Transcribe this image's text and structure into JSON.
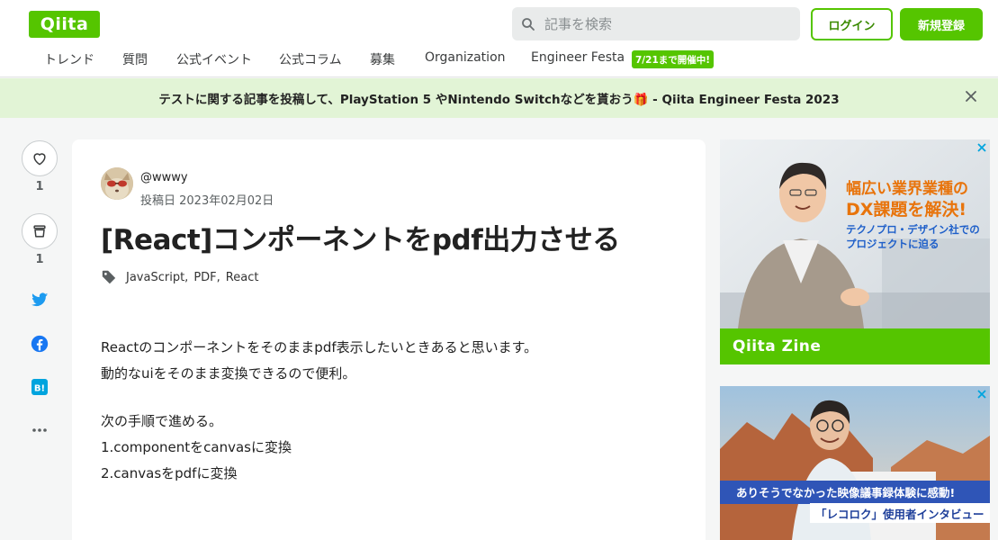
{
  "header": {
    "logo": "Qiita",
    "search_placeholder": "記事を検索",
    "login_label": "ログイン",
    "signup_label": "新規登録",
    "nav": [
      "トレンド",
      "質問",
      "公式イベント",
      "公式コラム",
      "募集",
      "Organization",
      "Engineer Festa"
    ],
    "nav_badge": "7/21まで開催中!"
  },
  "banner": {
    "text": "テストに関する記事を投稿して、PlayStation 5 やNintendo Switchなどを貰おう🎁 - Qiita Engineer Festa 2023"
  },
  "rail": {
    "likes_count": "1",
    "stocks_count": "1"
  },
  "article": {
    "username": "@wwwy",
    "posted": "投稿日 2023年02月02日",
    "title": "[React]コンポーネントをpdf出力させる",
    "tags": [
      "JavaScript",
      "PDF",
      "React"
    ],
    "body": [
      "Reactのコンポーネントをそのままpdf表示したいときあると思います。",
      "動的なuiをそのまま変換できるので便利。",
      "次の手順で進める。",
      "1.componentをcanvasに変換",
      "2.canvasをpdfに変換"
    ]
  },
  "ads": {
    "ad1_headline_1": "幅広い業界業種の",
    "ad1_headline_2": "DX課題を解決!",
    "ad1_sub_1": "テクノプロ・デザイン社での",
    "ad1_sub_2": "プロジェクトに迫る",
    "ad1_brand": "Qiita Zine",
    "ad2_line_1": "ありそうでなかった映像議事録体験に感動!",
    "ad2_line_2": "「レコロク」使用者インタビュー"
  },
  "colors": {
    "brand_green": "#55c500",
    "banner_bg": "#e2f4d6",
    "twitter": "#1d9bf0",
    "facebook": "#1877f2",
    "hatena": "#00a4de"
  }
}
